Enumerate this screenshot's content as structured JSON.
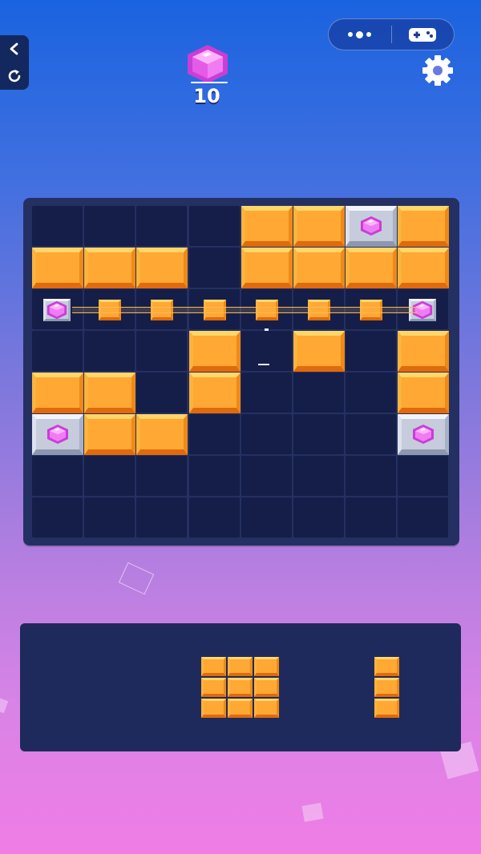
{
  "hud": {
    "gem_count": "10",
    "back_icon": "chevron-left-icon",
    "restart_icon": "refresh-icon",
    "more_icon": "more-dots-icon",
    "gamepad_icon": "gamepad-icon",
    "settings_icon": "gear-icon"
  },
  "board": {
    "rows": 8,
    "cols": 8,
    "grid": [
      [
        ".",
        ".",
        ".",
        ".",
        "B",
        "B",
        "S",
        "B"
      ],
      [
        "B",
        "B",
        "B",
        ".",
        "B",
        "B",
        "B",
        "B"
      ],
      [
        "S",
        "b",
        "b",
        "b",
        "b",
        "b",
        "b",
        "S"
      ],
      [
        ".",
        ".",
        ".",
        "B",
        ".",
        "B",
        ".",
        "B"
      ],
      [
        "B",
        "B",
        ".",
        "B",
        ".",
        ".",
        ".",
        "B"
      ],
      [
        "S",
        "B",
        "B",
        ".",
        ".",
        ".",
        ".",
        "S"
      ],
      [
        ".",
        ".",
        ".",
        ".",
        ".",
        ".",
        ".",
        "."
      ],
      [
        ".",
        ".",
        ".",
        ".",
        ".",
        ".",
        ".",
        "."
      ]
    ],
    "legend": {
      "B": "orange-block",
      "S": "gem-stone-block",
      "b": "clearing-block",
      ".": "empty"
    }
  },
  "tray": {
    "pieces": [
      {
        "shape": "3x3 square",
        "rows": 3,
        "cols": 3
      },
      {
        "shape": "1x3 vertical",
        "rows": 3,
        "cols": 1
      }
    ]
  },
  "colors": {
    "block": "#ffa834",
    "gem": "#e255e8",
    "board": "#243061",
    "cell": "#141e48",
    "tray": "#1f2a5c"
  }
}
